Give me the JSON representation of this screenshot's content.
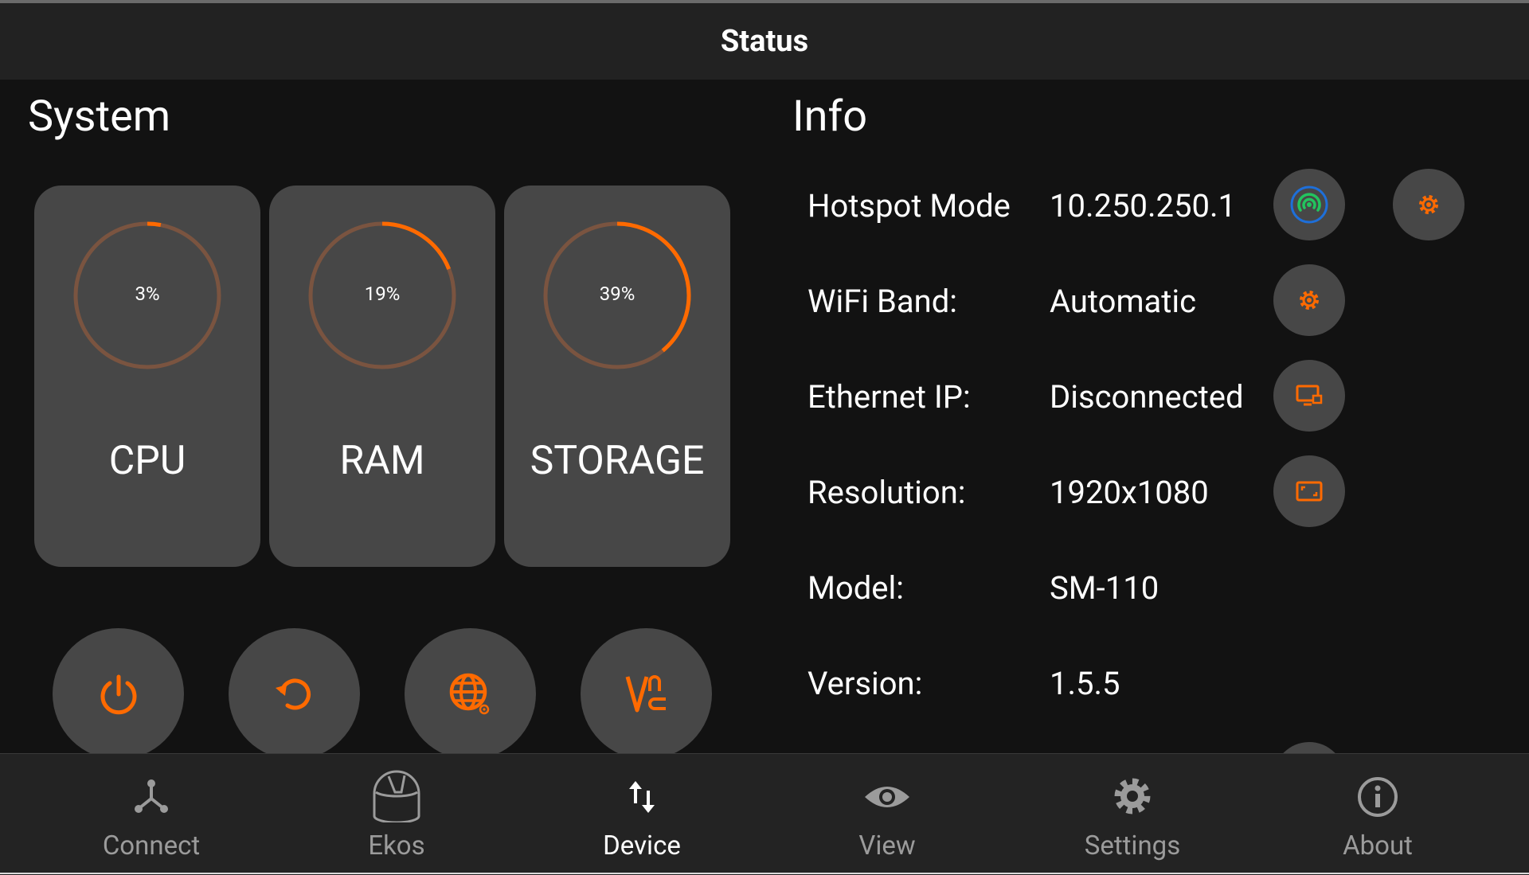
{
  "header": {
    "title": "Status"
  },
  "system": {
    "title": "System",
    "cards": [
      {
        "label": "CPU",
        "percent_text": "3%",
        "percent": 3
      },
      {
        "label": "RAM",
        "percent_text": "19%",
        "percent": 19
      },
      {
        "label": "STORAGE",
        "percent_text": "39%",
        "percent": 39
      }
    ],
    "actions": [
      {
        "icon": "power-icon"
      },
      {
        "icon": "restart-icon"
      },
      {
        "icon": "web-settings-icon"
      },
      {
        "icon": "vnc-icon"
      }
    ]
  },
  "info": {
    "title": "Info",
    "rows": [
      {
        "label": "Hotspot Mode",
        "value": "10.250.250.1"
      },
      {
        "label": "WiFi Band:",
        "value": "Automatic"
      },
      {
        "label": "Ethernet IP:",
        "value": "Disconnected"
      },
      {
        "label": "Resolution:",
        "value": "1920x1080"
      },
      {
        "label": "Model:",
        "value": "SM-110"
      },
      {
        "label": "Version:",
        "value": "1.5.5"
      }
    ]
  },
  "nav": {
    "items": [
      {
        "label": "Connect",
        "icon": "connect-icon"
      },
      {
        "label": "Ekos",
        "icon": "ekos-icon"
      },
      {
        "label": "Device",
        "icon": "device-icon",
        "active": true
      },
      {
        "label": "View",
        "icon": "eye-icon"
      },
      {
        "label": "Settings",
        "icon": "gear-icon"
      },
      {
        "label": "About",
        "icon": "info-icon"
      }
    ]
  },
  "colors": {
    "accent": "#ff6a00",
    "gauge_track": "#7a5440",
    "card_bg": "#474747",
    "hotspot_blue": "#1e6fd9",
    "hotspot_green": "#22c55e"
  }
}
